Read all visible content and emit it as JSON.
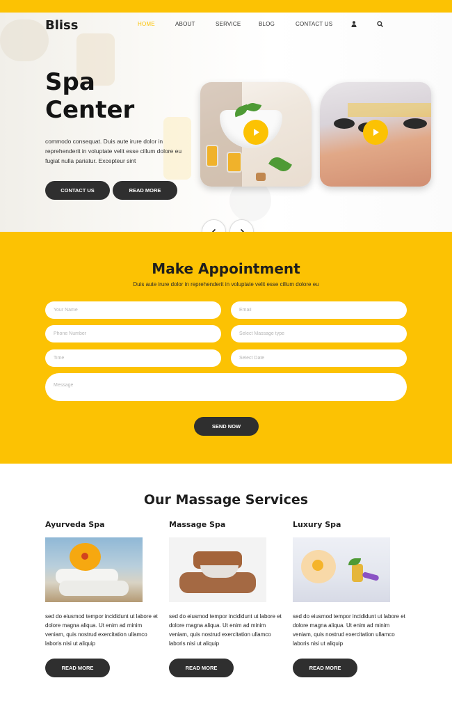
{
  "header": {
    "logo": "Bliss",
    "nav": [
      "HOME",
      "ABOUT",
      "SERVICE",
      "BLOG",
      "CONTACT US"
    ],
    "active_nav": "HOME",
    "icons": [
      "user-icon",
      "search-icon"
    ]
  },
  "hero": {
    "title_line1": "Spa",
    "title_line2": "Center",
    "text": "commodo consequat. Duis aute irure dolor in reprehenderit in voluptate velit esse cillum dolore eu fugiat nulla pariatur. Excepteur sint",
    "btn_contact": "CONTACT US",
    "btn_read": "READ MORE"
  },
  "appointment": {
    "title": "Make Appointment",
    "subtitle": "Duis aute irure dolor in reprehenderit in voluptate velit esse cillum dolore eu",
    "fields": {
      "name": "Your Name",
      "email": "Email",
      "phone": "Phone Number",
      "select": "Select Massage type",
      "time": "Time",
      "date": "Select Date",
      "message": "Message"
    },
    "submit": "SEND NOW"
  },
  "services": {
    "title": "Our Massage Services",
    "items": [
      {
        "name": "Ayurveda Spa",
        "text": "sed do eiusmod tempor incididunt ut labore et dolore magna aliqua. Ut enim ad minim veniam, quis nostrud exercitation ullamco laboris nisi ut aliquip",
        "button": "READ MORE"
      },
      {
        "name": "Massage Spa",
        "text": "sed do eiusmod tempor incididunt ut labore et dolore magna aliqua. Ut enim ad minim veniam, quis nostrud exercitation ullamco laboris nisi ut aliquip",
        "button": "READ MORE"
      },
      {
        "name": "Luxury Spa",
        "text": "sed do eiusmod tempor incididunt ut labore et dolore magna aliqua. Ut enim ad minim veniam, quis nostrud exercitation ullamco laboris nisi ut aliquip",
        "button": "READ MORE"
      }
    ]
  },
  "colors": {
    "accent": "#fcc203",
    "dark": "#2f2f2f",
    "text": "#1c1c1c"
  }
}
